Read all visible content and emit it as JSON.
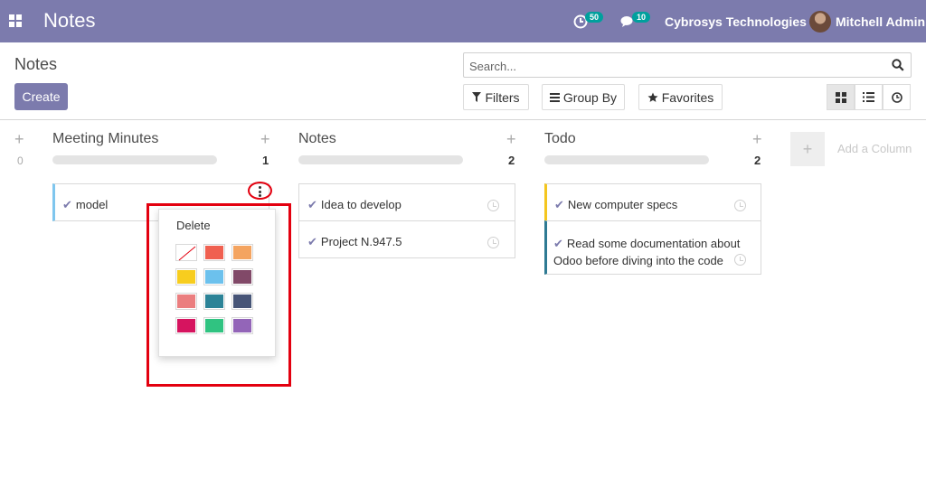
{
  "navbar": {
    "app_title": "Notes",
    "activity_count": "50",
    "messages_count": "10",
    "company": "Cybrosys Technologies",
    "user": "Mitchell Admin"
  },
  "control_panel": {
    "breadcrumb": "Notes",
    "create_label": "Create",
    "search_placeholder": "Search...",
    "filters_label": "Filters",
    "groupby_label": "Group By",
    "favorites_label": "Favorites",
    "views": [
      "kanban-icon",
      "list-icon",
      "activity-icon"
    ],
    "active_view": "kanban"
  },
  "kanban": {
    "columns": [
      {
        "title": "Meeting Minutes",
        "count": "1",
        "zero": "0",
        "cards": [
          {
            "text": "model",
            "accent": "#7fc6ee"
          }
        ]
      },
      {
        "title": "Notes",
        "count": "2",
        "cards": [
          {
            "text": "Idea to develop"
          },
          {
            "text": "Project N.947.5"
          }
        ]
      },
      {
        "title": "Todo",
        "count": "2",
        "cards": [
          {
            "text": "New computer specs",
            "accent": "#f4c61f"
          },
          {
            "text": "Read some documentation about Odoo before diving into the code",
            "accent": "#2e7a93"
          }
        ]
      }
    ],
    "add_column_label": "Add a Column"
  },
  "dropdown": {
    "delete_label": "Delete",
    "colors": [
      "none",
      "#f06050",
      "#f4a460",
      "#f7cd1f",
      "#6cc1ed",
      "#814968",
      "#eb7e7f",
      "#2c8397",
      "#475577",
      "#d6145f",
      "#30c381",
      "#9365b8"
    ]
  },
  "theme": {
    "primary": "#7c7bad",
    "badge": "#00a09d",
    "annotation": "#e3000f"
  }
}
